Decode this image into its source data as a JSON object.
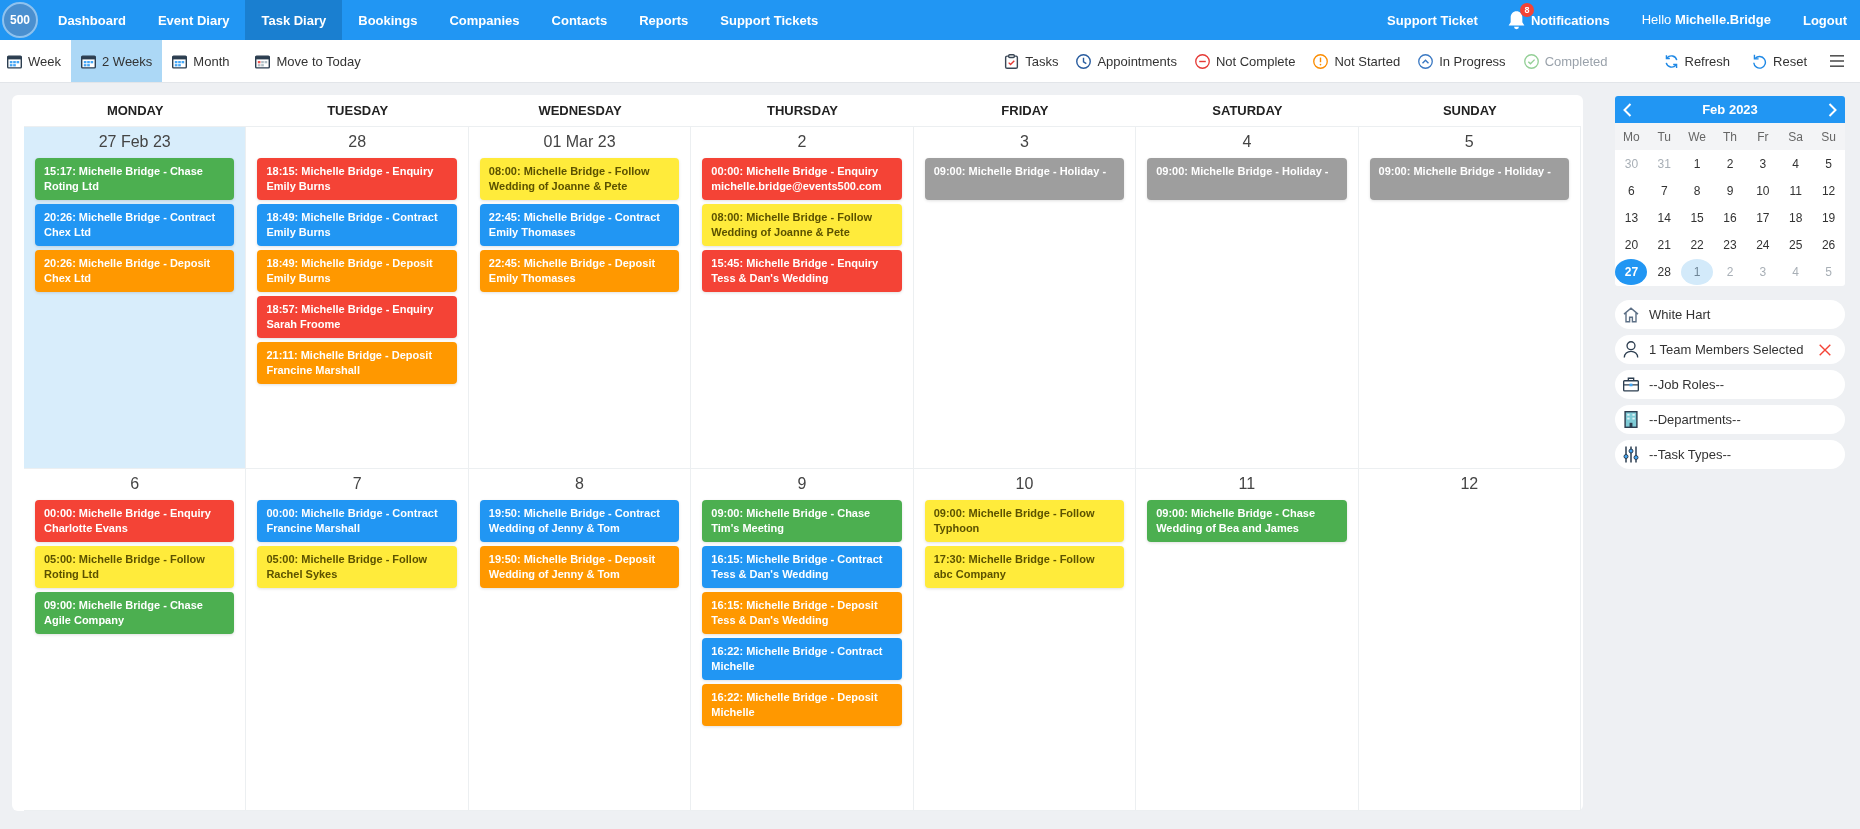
{
  "nav": {
    "logo": "500",
    "items": [
      {
        "label": "Dashboard",
        "selected": false
      },
      {
        "label": "Event Diary",
        "selected": false
      },
      {
        "label": "Task Diary",
        "selected": true
      },
      {
        "label": "Bookings",
        "selected": false
      },
      {
        "label": "Companies",
        "selected": false
      },
      {
        "label": "Contacts",
        "selected": false
      },
      {
        "label": "Reports",
        "selected": false
      },
      {
        "label": "Support Tickets",
        "selected": false
      }
    ],
    "support": "Support Ticket",
    "notifications": {
      "label": "Notifications",
      "badge": "8"
    },
    "greeting": "Hello **Michelle.Bridge**",
    "logout": "Logout"
  },
  "toolbar": {
    "views": [
      {
        "label": "Week",
        "selected": false
      },
      {
        "label": "2 Weeks",
        "selected": true
      },
      {
        "label": "Month",
        "selected": false
      }
    ],
    "move_today": "Move to Today",
    "legend": [
      {
        "kind": "tasks",
        "label": "Tasks",
        "disabled": false
      },
      {
        "kind": "appointments",
        "label": "Appointments",
        "disabled": false
      },
      {
        "kind": "not_complete",
        "label": "Not Complete",
        "disabled": false
      },
      {
        "kind": "not_started",
        "label": "Not Started",
        "disabled": false
      },
      {
        "kind": "in_progress",
        "label": "In Progress",
        "disabled": false
      },
      {
        "kind": "completed",
        "label": "Completed",
        "disabled": true
      }
    ],
    "actions": [
      {
        "kind": "refresh",
        "label": "Refresh"
      },
      {
        "kind": "reset",
        "label": "Reset"
      }
    ]
  },
  "calendar": {
    "weekdays": [
      "MONDAY",
      "TUESDAY",
      "WEDNESDAY",
      "THURSDAY",
      "FRIDAY",
      "SATURDAY",
      "SUNDAY"
    ],
    "weeks": [
      {
        "days": [
          {
            "date": "27 Feb 23",
            "selected": true,
            "events": [
              {
                "title": "15:17: Michelle Bridge - Chase",
                "detail": "Roting Ltd",
                "color": "#4caf50"
              },
              {
                "title": "20:26: Michelle Bridge - Contract",
                "detail": "Chex Ltd",
                "color": "#2196f3"
              },
              {
                "title": "20:26: Michelle Bridge - Deposit",
                "detail": "Chex Ltd",
                "color": "#ff9800"
              }
            ]
          },
          {
            "date": "28",
            "selected": false,
            "events": [
              {
                "title": "18:15: Michelle Bridge - Enquiry",
                "detail": "Emily Burns",
                "color": "#f44336"
              },
              {
                "title": "18:49: Michelle Bridge - Contract",
                "detail": "Emily Burns",
                "color": "#2196f3"
              },
              {
                "title": "18:49: Michelle Bridge - Deposit",
                "detail": "Emily Burns",
                "color": "#ff9800"
              },
              {
                "title": "18:57: Michelle Bridge - Enquiry",
                "detail": "Sarah Froome",
                "color": "#f44336"
              },
              {
                "title": "21:11: Michelle Bridge - Deposit",
                "detail": "Francine Marshall",
                "color": "#ff9800"
              }
            ]
          },
          {
            "date": "01 Mar 23",
            "selected": false,
            "events": [
              {
                "title": "08:00: Michelle Bridge - Follow",
                "detail": "Wedding of Joanne & Pete",
                "color": "#ffeb3b"
              },
              {
                "title": "22:45: Michelle Bridge - Contract",
                "detail": "Emily Thomases",
                "color": "#2196f3"
              },
              {
                "title": "22:45: Michelle Bridge - Deposit",
                "detail": "Emily Thomases",
                "color": "#ff9800"
              }
            ]
          },
          {
            "date": "2",
            "selected": false,
            "events": [
              {
                "title": "00:00: Michelle Bridge - Enquiry",
                "detail": "michelle.bridge@events500.com",
                "color": "#f44336"
              },
              {
                "title": "08:00: Michelle Bridge - Follow",
                "detail": "Wedding of Joanne & Pete",
                "color": "#ffeb3b"
              },
              {
                "title": "15:45: Michelle Bridge - Enquiry",
                "detail": "Tess & Dan's Wedding",
                "color": "#f44336"
              }
            ]
          },
          {
            "date": "3",
            "selected": false,
            "events": [
              {
                "title": "09:00: Michelle Bridge - Holiday -",
                "color": "#9e9e9e"
              }
            ]
          },
          {
            "date": "4",
            "selected": false,
            "events": [
              {
                "title": "09:00: Michelle Bridge - Holiday -",
                "color": "#9e9e9e"
              }
            ]
          },
          {
            "date": "5",
            "selected": false,
            "events": [
              {
                "title": "09:00: Michelle Bridge - Holiday -",
                "color": "#9e9e9e"
              }
            ]
          }
        ]
      },
      {
        "days": [
          {
            "date": "6",
            "selected": false,
            "events": [
              {
                "title": "00:00: Michelle Bridge - Enquiry",
                "detail": "Charlotte Evans",
                "color": "#f44336"
              },
              {
                "title": "05:00: Michelle Bridge - Follow",
                "detail": "Roting Ltd",
                "color": "#ffeb3b"
              },
              {
                "title": "09:00: Michelle Bridge - Chase",
                "detail": "Agile Company",
                "color": "#4caf50"
              }
            ]
          },
          {
            "date": "7",
            "selected": false,
            "events": [
              {
                "title": "00:00: Michelle Bridge - Contract",
                "detail": "Francine Marshall",
                "color": "#2196f3"
              },
              {
                "title": "05:00: Michelle Bridge - Follow",
                "detail": "Rachel Sykes",
                "color": "#ffeb3b"
              }
            ]
          },
          {
            "date": "8",
            "selected": false,
            "events": [
              {
                "title": "19:50: Michelle Bridge - Contract",
                "detail": "Wedding of Jenny & Tom",
                "color": "#2196f3"
              },
              {
                "title": "19:50: Michelle Bridge - Deposit",
                "detail": "Wedding of Jenny & Tom",
                "color": "#ff9800"
              }
            ]
          },
          {
            "date": "9",
            "selected": false,
            "events": [
              {
                "title": "09:00: Michelle Bridge - Chase",
                "detail": "Tim's Meeting",
                "color": "#4caf50"
              },
              {
                "title": "16:15: Michelle Bridge - Contract",
                "detail": "Tess & Dan's Wedding",
                "color": "#2196f3"
              },
              {
                "title": "16:15: Michelle Bridge - Deposit",
                "detail": "Tess & Dan's Wedding",
                "color": "#ff9800"
              },
              {
                "title": "16:22: Michelle Bridge - Contract",
                "detail": "Michelle",
                "color": "#2196f3"
              },
              {
                "title": "16:22: Michelle Bridge - Deposit",
                "detail": "Michelle",
                "color": "#ff9800"
              }
            ]
          },
          {
            "date": "10",
            "selected": false,
            "events": [
              {
                "title": "09:00: Michelle Bridge - Follow",
                "detail": "Typhoon",
                "color": "#ffeb3b"
              },
              {
                "title": "17:30: Michelle Bridge - Follow",
                "detail": "abc Company",
                "color": "#ffeb3b"
              }
            ]
          },
          {
            "date": "11",
            "selected": false,
            "events": [
              {
                "title": "09:00: Michelle Bridge - Chase",
                "detail": "Wedding of Bea and James",
                "color": "#4caf50"
              }
            ]
          },
          {
            "date": "12",
            "selected": false
          }
        ]
      }
    ]
  },
  "sidebar": {
    "mini_calendar": {
      "title": "Feb 2023",
      "weekdays": [
        "Mo",
        "Tu",
        "We",
        "Th",
        "Fr",
        "Sa",
        "Su"
      ],
      "days": [
        {
          "day": "30",
          "muted": true,
          "selected": false,
          "highlighted": false
        },
        {
          "day": "31",
          "muted": true,
          "selected": false,
          "highlighted": false
        },
        {
          "day": "1",
          "muted": false,
          "selected": false,
          "highlighted": false
        },
        {
          "day": "2",
          "muted": false,
          "selected": false,
          "highlighted": false
        },
        {
          "day": "3",
          "muted": false,
          "selected": false,
          "highlighted": false
        },
        {
          "day": "4",
          "muted": false,
          "selected": false,
          "highlighted": false
        },
        {
          "day": "5",
          "muted": false,
          "selected": false,
          "highlighted": false
        },
        {
          "day": "6",
          "muted": false,
          "selected": false,
          "highlighted": false
        },
        {
          "day": "7",
          "muted": false,
          "selected": false,
          "highlighted": false
        },
        {
          "day": "8",
          "muted": false,
          "selected": false,
          "highlighted": false
        },
        {
          "day": "9",
          "muted": false,
          "selected": false,
          "highlighted": false
        },
        {
          "day": "10",
          "muted": false,
          "selected": false,
          "highlighted": false
        },
        {
          "day": "11",
          "muted": false,
          "selected": false,
          "highlighted": false
        },
        {
          "day": "12",
          "muted": false,
          "selected": false,
          "highlighted": false
        },
        {
          "day": "13",
          "muted": false,
          "selected": false,
          "highlighted": false
        },
        {
          "day": "14",
          "muted": false,
          "selected": false,
          "highlighted": false
        },
        {
          "day": "15",
          "muted": false,
          "selected": false,
          "highlighted": false
        },
        {
          "day": "16",
          "muted": false,
          "selected": false,
          "highlighted": false
        },
        {
          "day": "17",
          "muted": false,
          "selected": false,
          "highlighted": false
        },
        {
          "day": "18",
          "muted": false,
          "selected": false,
          "highlighted": false
        },
        {
          "day": "19",
          "muted": false,
          "selected": false,
          "highlighted": false
        },
        {
          "day": "20",
          "muted": false,
          "selected": false,
          "highlighted": false
        },
        {
          "day": "21",
          "muted": false,
          "selected": false,
          "highlighted": false
        },
        {
          "day": "22",
          "muted": false,
          "selected": false,
          "highlighted": false
        },
        {
          "day": "23",
          "muted": false,
          "selected": false,
          "highlighted": false
        },
        {
          "day": "24",
          "muted": false,
          "selected": false,
          "highlighted": false
        },
        {
          "day": "25",
          "muted": false,
          "selected": false,
          "highlighted": false
        },
        {
          "day": "26",
          "muted": false,
          "selected": false,
          "highlighted": false
        },
        {
          "day": "27",
          "muted": false,
          "selected": true,
          "highlighted": false
        },
        {
          "day": "28",
          "muted": false,
          "selected": false,
          "highlighted": false
        },
        {
          "day": "1",
          "muted": true,
          "selected": false,
          "highlighted": true
        },
        {
          "day": "2",
          "muted": true,
          "selected": false,
          "highlighted": false
        },
        {
          "day": "3",
          "muted": true,
          "selected": false,
          "highlighted": false
        },
        {
          "day": "4",
          "muted": true,
          "selected": false,
          "highlighted": false
        },
        {
          "day": "5",
          "muted": true,
          "selected": false,
          "highlighted": false
        }
      ]
    },
    "filters": [
      {
        "kind": "venue",
        "label": "White Hart",
        "clearable": false
      },
      {
        "kind": "team",
        "label": "1 Team Members Selected",
        "clearable": true
      },
      {
        "kind": "job_roles",
        "label": "--Job Roles--",
        "clearable": false
      },
      {
        "kind": "departments",
        "label": "--Departments--",
        "clearable": false
      },
      {
        "kind": "task_types",
        "label": "--Task Types--",
        "clearable": false
      }
    ]
  }
}
